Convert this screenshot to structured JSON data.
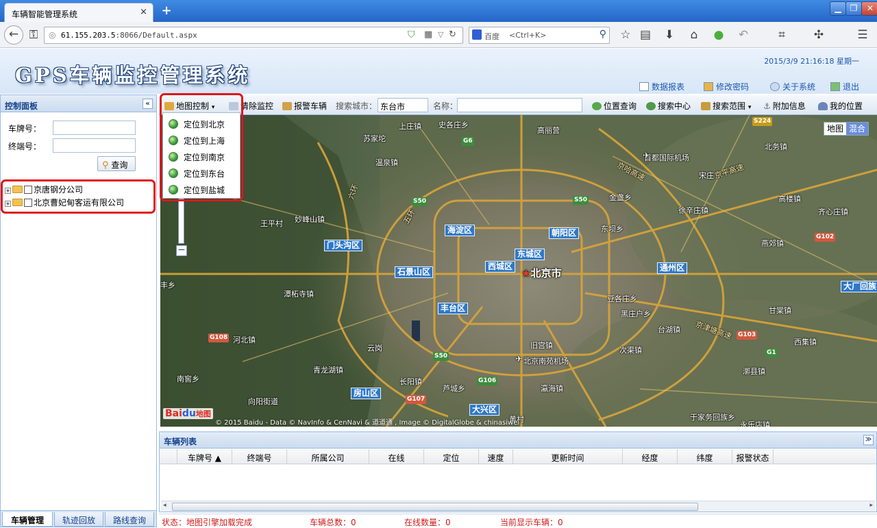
{
  "browser": {
    "tab_title": "车辆智能管理系统",
    "tab_close": "×",
    "new_tab": "+",
    "url_host": "61.155.203.5",
    "url_rest": ":8066/Default.aspx",
    "search_engine": "百度",
    "search_placeholder": "<Ctrl+K>"
  },
  "header": {
    "title": "GPS车辆监控管理系统",
    "datetime": "2015/3/9 21:16:18 星期一",
    "links": {
      "reports": "数据报表",
      "change_password": "修改密码",
      "about": "关于系统",
      "logout": "退出"
    }
  },
  "left_panel": {
    "title": "控制面板",
    "collapse": "«",
    "plate_label": "车牌号：",
    "terminal_label": "终端号：",
    "query_button": "查询",
    "tree": [
      {
        "label": "京唐钢分公司"
      },
      {
        "label": "北京曹妃甸客运有限公司"
      }
    ],
    "tabs": [
      "车辆管理",
      "轨迹回放",
      "路线查询"
    ]
  },
  "toolbar": {
    "map_control": "地图控制",
    "clear_monitor": "清除监控",
    "alarm_vehicle": "报警车辆",
    "search_city_label": "搜索城市：",
    "search_city_value": "东台市",
    "name_label": "名称：",
    "name_value": "",
    "position_query": "位置查询",
    "search_center": "搜索中心",
    "search_range": "搜索范围",
    "extra_info": "附加信息",
    "my_location": "我的位置"
  },
  "dropdown": {
    "items": [
      "定位到北京",
      "定位到上海",
      "定位到南京",
      "定位到东台",
      "定位到盐城"
    ]
  },
  "map": {
    "city": "北京市",
    "type_map": "地图",
    "type_hybrid": "混合",
    "logo_bai": "Bai",
    "logo_du": "du",
    "logo_map": "地图",
    "copyright": "© 2015 Baidu - Data © NavInfo & CenNavi & 道道通 , Image © DigitalGlobe & chinasiwei",
    "zoom_minus": "−",
    "districts": [
      "海淀区",
      "朝阳区",
      "门头沟区",
      "东城区",
      "西城区",
      "石景山区",
      "通州区",
      "丰台区",
      "房山区",
      "大兴区",
      "大厂回族"
    ],
    "places": [
      "上庄镇",
      "史各庄乡",
      "苏家坨",
      "高丽营",
      "温泉镇",
      "首都国际机场",
      "北务镇",
      "宋庄",
      "王平村",
      "妙峰山镇",
      "金盏乡",
      "徐辛庄镇",
      "高楼镇",
      "齐心庄镇",
      "东坝乡",
      "燕郊镇",
      "潭柘寺镇",
      "豆各庄乡",
      "黑庄户乡",
      "甘棠镇",
      "河北镇",
      "台湖镇",
      "云岗",
      "旧宫镇",
      "次渠镇",
      "西集镇",
      "青龙湖镇",
      "长阳镇",
      "北京南苑机场",
      "南窖乡",
      "芦城乡",
      "瀛海镇",
      "漷县镇",
      "向阳街道",
      "黄村",
      "于家务回族乡",
      "永乐店镇",
      "丰乡",
      "京平高速",
      "京津塘高速",
      "京哈高速",
      "六环",
      "五环"
    ],
    "shields": [
      "S224",
      "G6",
      "S50",
      "S50",
      "S50",
      "G102",
      "G108",
      "G103",
      "G1",
      "G106",
      "G107"
    ]
  },
  "vehicle_list": {
    "title": "车辆列表",
    "collapse": "≫",
    "columns": [
      "车牌号 ▲",
      "终端号",
      "所属公司",
      "在线",
      "定位",
      "速度",
      "更新时间",
      "经度",
      "纬度",
      "报警状态"
    ]
  },
  "status": {
    "state": "状态：地图引擎加载完成",
    "total": "车辆总数：0",
    "online": "在线数量：0",
    "shown": "当前显示车辆：0"
  },
  "colors": {
    "highlight": "#e0161a",
    "panel_title": "#15428b",
    "status_text": "#d01a1a",
    "district_badge": "#2f78c8"
  }
}
